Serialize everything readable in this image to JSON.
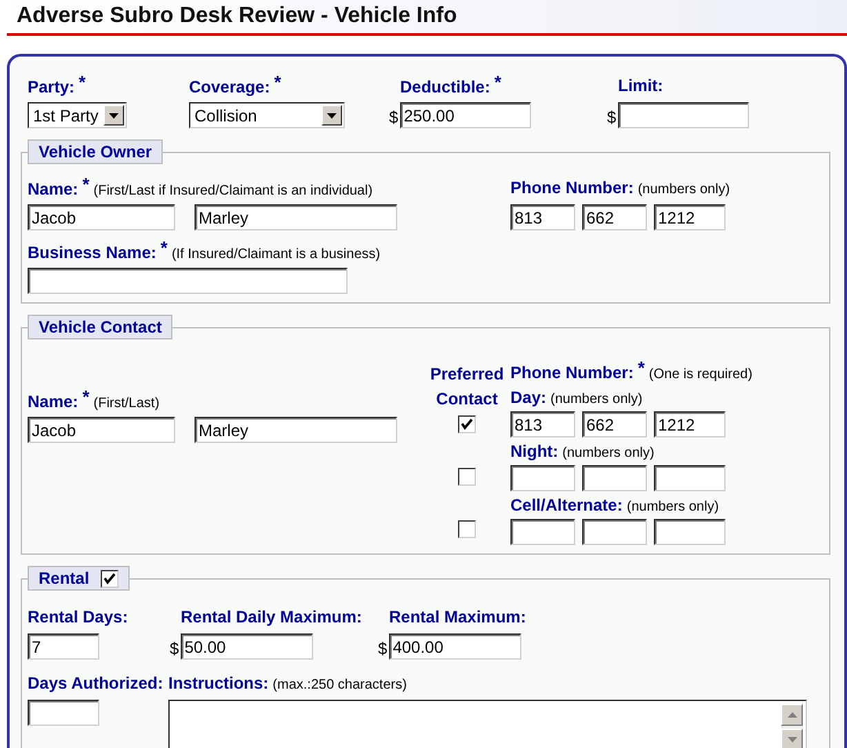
{
  "title": "Adverse Subro Desk Review - Vehicle Info",
  "top_fields": [
    {
      "kind": "select",
      "label": "Party:",
      "marker": "*",
      "value": "1st Party"
    },
    {
      "kind": "select",
      "label": "Coverage:",
      "marker": "*",
      "value": "Collision"
    },
    {
      "kind": "money",
      "label": "Deductible:",
      "marker": "*",
      "currency": "$",
      "value": "250.00"
    },
    {
      "kind": "money",
      "label": "Limit:",
      "currency": "$"
    }
  ],
  "owner": {
    "legend": "Vehicle Owner",
    "name": {
      "label": "Name:",
      "marker": "*",
      "hint": "(First/Last if Insured/Claimant is an individual)",
      "first": "Jacob",
      "last": "Marley"
    },
    "phone": {
      "label": "Phone Number:",
      "hint": "(numbers only)",
      "parts": [
        "813",
        "662",
        "1212"
      ]
    },
    "business": {
      "label": "Business Name:",
      "marker": "*",
      "hint": "(If Insured/Claimant is a business)"
    }
  },
  "contact": {
    "legend": "Vehicle Contact",
    "preferred_heading": "Preferred Contact",
    "name": {
      "label": "Name:",
      "marker": "*",
      "hint": "(First/Last)",
      "first": "Jacob",
      "last": "Marley"
    },
    "phone_heading": {
      "label": "Phone Number:",
      "marker": "*",
      "hint": "(One is required)"
    },
    "phones": [
      {
        "label": "Day:",
        "hint": "(numbers only)",
        "preferred": true,
        "parts": [
          "813",
          "662",
          "1212"
        ]
      },
      {
        "label": "Night:",
        "hint": "(numbers only)",
        "preferred": false
      },
      {
        "label": "Cell/Alternate:",
        "hint": "(numbers only)",
        "preferred": false
      }
    ]
  },
  "rental": {
    "legend": "Rental",
    "checked": true,
    "days": {
      "label": "Rental Days:",
      "value": "7"
    },
    "daily_max": {
      "label": "Rental Daily Maximum:",
      "currency": "$",
      "value": "50.00"
    },
    "max": {
      "label": "Rental Maximum:",
      "currency": "$",
      "value": "400.00"
    },
    "days_authorized": {
      "label": "Days Authorized:"
    },
    "instructions": {
      "label": "Instructions:",
      "hint": "(max.:250 characters)"
    }
  }
}
